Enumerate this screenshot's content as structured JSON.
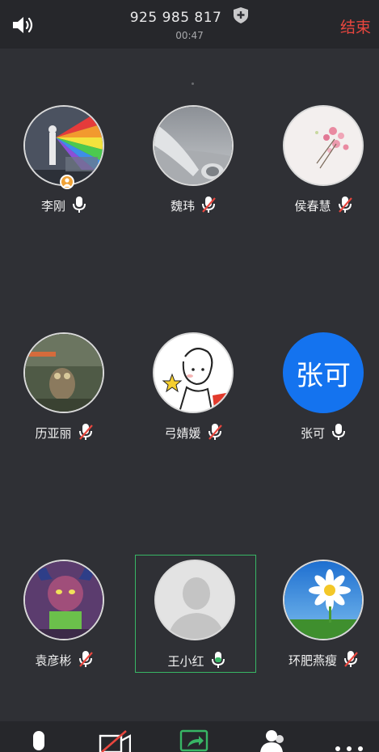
{
  "header": {
    "meeting_id": "925 985 817",
    "timer": "00:47",
    "end_label": "结束"
  },
  "participants": [
    {
      "name": "李刚",
      "mic": "on",
      "host": true
    },
    {
      "name": "魏玮",
      "mic": "muted"
    },
    {
      "name": "侯春慧",
      "mic": "muted"
    },
    {
      "name": "历亚丽",
      "mic": "muted"
    },
    {
      "name": "弓婧媛",
      "mic": "muted"
    },
    {
      "name": "张可",
      "mic": "on",
      "avatar_text": "张可"
    },
    {
      "name": "袁彦彬",
      "mic": "muted"
    },
    {
      "name": "王小红",
      "mic": "speaking",
      "active": true
    },
    {
      "name": "环肥燕瘦",
      "mic": "muted"
    }
  ],
  "colors": {
    "background": "#2f3035",
    "bar": "#26272b",
    "end": "#e8463e",
    "active_border": "#38b665",
    "muted": "#e8463e",
    "speaking": "#38b665",
    "text_avatar_bg": "#1473ef",
    "host_badge": "#f0a236"
  },
  "toolbar": {
    "icons": [
      "mic-icon",
      "video-off-icon",
      "share-screen-icon",
      "participants-icon",
      "more-icon"
    ]
  }
}
